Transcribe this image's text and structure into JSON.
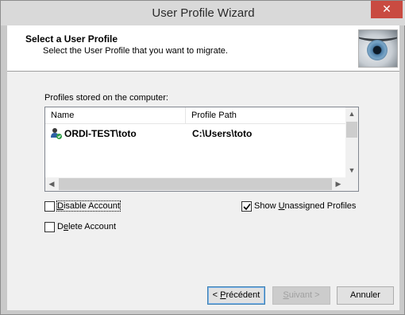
{
  "window": {
    "title": "User Profile Wizard",
    "close_glyph": "✕"
  },
  "header": {
    "title": "Select a User Profile",
    "subtitle": "Select the User Profile that you want to migrate."
  },
  "profiles": {
    "label": "Profiles stored on the computer:",
    "columns": [
      "Name",
      "Profile Path"
    ],
    "rows": [
      {
        "name": "ORDI-TEST\\toto",
        "path": "C:\\Users\\toto",
        "icon": "user-profile-icon"
      }
    ]
  },
  "options": {
    "disable_account": {
      "pre": "",
      "key": "D",
      "post": "isable Account",
      "checked": false
    },
    "delete_account": {
      "pre": "D",
      "key": "e",
      "post": "lete Account",
      "checked": false
    },
    "show_unassigned": {
      "pre": "Show ",
      "key": "U",
      "post": "nassigned Profiles",
      "checked": true
    }
  },
  "buttons": {
    "back": {
      "pre": "< ",
      "key": "P",
      "post": "récédent"
    },
    "next": {
      "pre": "",
      "key": "S",
      "post": "uivant >"
    },
    "cancel": "Annuler"
  },
  "colors": {
    "close_button": "#c94b41",
    "default_button_border": "#3c7fb1"
  }
}
